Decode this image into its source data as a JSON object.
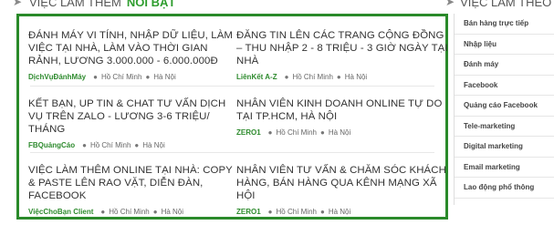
{
  "section": {
    "title_prefix": "VIỆC LÀM THÊM",
    "title_highlight": "NỔI BẬT"
  },
  "jobs": [
    {
      "title": "ĐÁNH MÁY VI TÍNH, NHẬP DỮ LIỆU, LÀM VIỆC TẠI NHÀ, LÀM VÀO THỜI GIAN RẢNH, LƯƠNG 3.000.000 - 6.000.000Đ",
      "company": "DịchVụĐánhMáy",
      "locations": [
        "Hồ Chí Minh",
        "Hà Nội"
      ]
    },
    {
      "title": "ĐĂNG TIN LÊN CÁC TRANG CỘNG ĐỒNG – THU NHẬP 2 - 8 TRIỆU - 3 GIỜ NGÀY TẠI NHÀ",
      "company": "LiênKết A-Z",
      "locations": [
        "Hồ Chí Minh",
        "Hà Nội"
      ]
    },
    {
      "title": "KẾT BẠN, UP TIN & CHAT TƯ VẤN DỊCH VỤ TRÊN ZALO - LƯƠNG 3-6 TRIỆU/ THÁNG",
      "company": "FBQuảngCáo",
      "locations": [
        "Hồ Chí Minh",
        "Hà Nội"
      ]
    },
    {
      "title": "NHÂN VIÊN KINH DOANH ONLINE TỰ DO TẠI TP.HCM, HÀ NỘI",
      "company": "ZERO1",
      "locations": [
        "Hồ Chí Minh",
        "Hà Nội"
      ]
    },
    {
      "title": "VIỆC LÀM THÊM ONLINE TẠI NHÀ: COPY & PASTE LÊN RAO VẶT, DIỄN ĐÀN, FACEBOOK",
      "company": "ViệcChoBạn Client",
      "locations": [
        "Hồ Chí Minh",
        "Hà Nội"
      ]
    },
    {
      "title": "NHÂN VIÊN TƯ VẤN & CHĂM SÓC KHÁCH HÀNG, BÁN HÀNG QUA KÊNH MẠNG XÃ HỘI",
      "company": "ZERO1",
      "locations": [
        "Hồ Chí Minh",
        "Hà Nội"
      ]
    }
  ],
  "sidebar": {
    "title": "VIỆC LÀM THEO T",
    "items": [
      "Bán hàng trực tiếp",
      "Nhập liệu",
      "Đánh máy",
      "Facebook",
      "Quảng cáo Facebook",
      "Tele-marketing",
      "Digital marketing",
      "Email marketing",
      "Lao động phổ thông"
    ]
  },
  "colors": {
    "accent": "#2e9d2e",
    "border": "#2a8a2a"
  }
}
